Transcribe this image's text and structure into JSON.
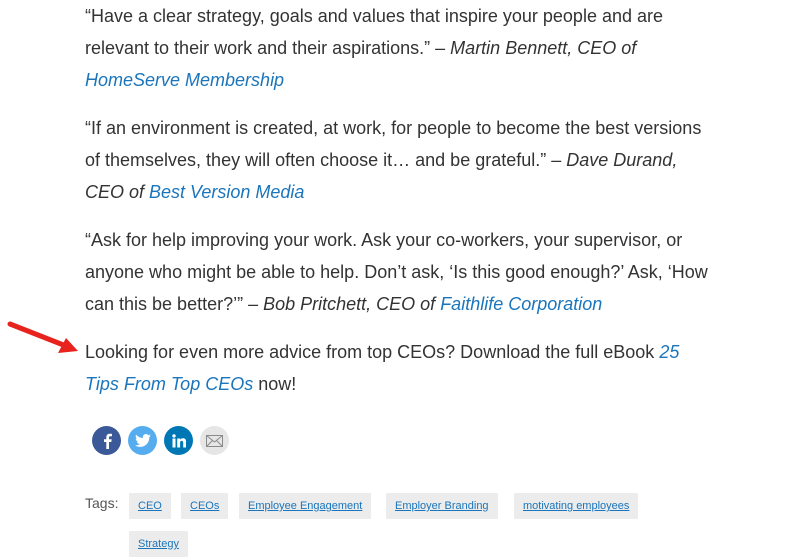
{
  "quotes": [
    {
      "text": "“Have a clear strategy, goals and values that inspire your people and are relevant to their work and their aspirations.”",
      "attribution": " – Martin Bennett, CEO of ",
      "link": "HomeServe Membership"
    },
    {
      "text": "“If an environment is created, at work, for people to become the best versions of themselves, they will often choose it… and be grateful.”",
      "attribution": " – Dave Durand, CEO of ",
      "link": "Best Version Media"
    },
    {
      "text": "“Ask for help improving your work. Ask your co-workers, your supervisor, or anyone who might be able to help. Don’t ask, ‘Is this good enough?’ Ask, ‘How can this be better?’”",
      "attribution": " – Bob Pritchett, CEO of ",
      "link": "Faithlife Corporation"
    }
  ],
  "cta": {
    "text": "Looking for even more advice from top CEOs? Download the full eBook ",
    "link": "25 Tips From Top CEOs",
    "suffix": " now!"
  },
  "social": {
    "facebook_icon": "facebook-icon",
    "twitter_icon": "twitter-icon",
    "linkedin_icon": "linkedin-icon",
    "email_icon": "email-icon"
  },
  "tags": {
    "label": "Tags:",
    "items": [
      "CEO",
      "CEOs",
      "Employee Engagement",
      "Employer Branding",
      "motivating employees",
      "Strategy"
    ]
  },
  "colors": {
    "link": "#1a75bc",
    "arrow": "#e8231e",
    "facebook": "#3b5998",
    "twitter": "#55acee",
    "linkedin": "#0077b5"
  }
}
